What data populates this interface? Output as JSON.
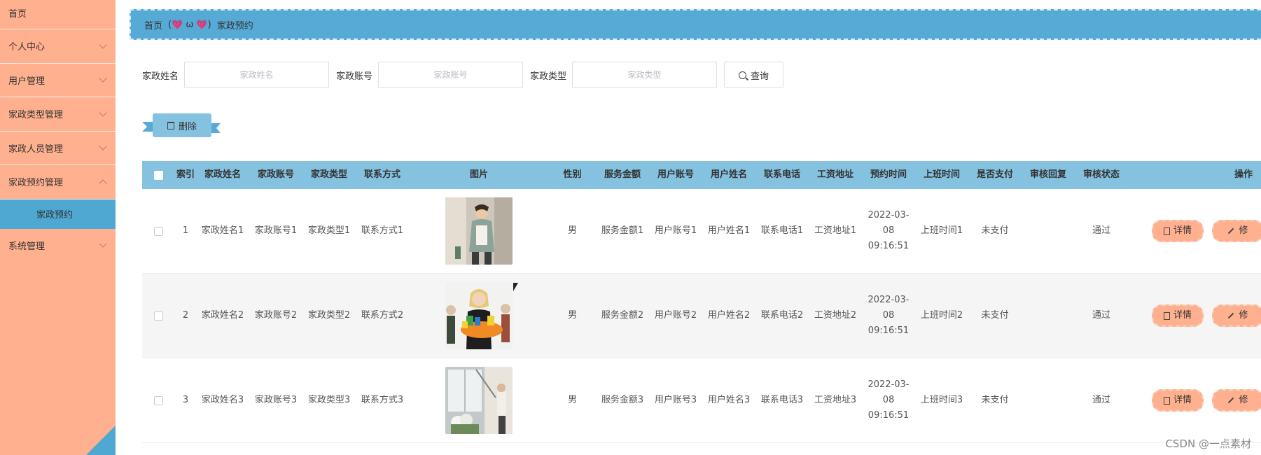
{
  "sidebar": {
    "items": [
      {
        "label": "首页"
      },
      {
        "label": "个人中心"
      },
      {
        "label": "用户管理"
      },
      {
        "label": "家政类型管理"
      },
      {
        "label": "家政人员管理"
      },
      {
        "label": "家政预约管理"
      },
      {
        "label": "系统管理"
      }
    ],
    "submenu_active": "家政预约"
  },
  "breadcrumb": {
    "home": "首页",
    "sep": "(💗 ω 💗)",
    "current": "家政预约"
  },
  "search": {
    "name_label": "家政姓名",
    "name_placeholder": "家政姓名",
    "account_label": "家政账号",
    "account_placeholder": "家政账号",
    "type_label": "家政类型",
    "type_placeholder": "家政类型",
    "query_label": "查询"
  },
  "toolbar": {
    "delete_label": "删除"
  },
  "table": {
    "headers": [
      "索引",
      "家政姓名",
      "家政账号",
      "家政类型",
      "联系方式",
      "图片",
      "性别",
      "服务金额",
      "用户账号",
      "用户姓名",
      "联系电话",
      "工资地址",
      "预约时间",
      "上班时间",
      "是否支付",
      "审核回复",
      "审核状态",
      "操作"
    ],
    "rows": [
      {
        "idx": "1",
        "name": "家政姓名1",
        "account": "家政账号1",
        "type": "家政类型1",
        "contact": "联系方式1",
        "sex": "男",
        "amount": "服务金额1",
        "user_account": "用户账号1",
        "user_name": "用户姓名1",
        "phone": "联系电话1",
        "address": "工资地址1",
        "time": "2022-03-08 09:16:51",
        "work_time": "上班时间1",
        "paid": "未支付",
        "reply": "",
        "status": "通过"
      },
      {
        "idx": "2",
        "name": "家政姓名2",
        "account": "家政账号2",
        "type": "家政类型2",
        "contact": "联系方式2",
        "sex": "男",
        "amount": "服务金额2",
        "user_account": "用户账号2",
        "user_name": "用户姓名2",
        "phone": "联系电话2",
        "address": "工资地址2",
        "time": "2022-03-08 09:16:51",
        "work_time": "上班时间2",
        "paid": "未支付",
        "reply": "",
        "status": "通过"
      },
      {
        "idx": "3",
        "name": "家政姓名3",
        "account": "家政账号3",
        "type": "家政类型3",
        "contact": "联系方式3",
        "sex": "男",
        "amount": "服务金额3",
        "user_account": "用户账号3",
        "user_name": "用户姓名3",
        "phone": "联系电话3",
        "address": "工资地址3",
        "time": "2022-03-08 09:16:51",
        "work_time": "上班时间3",
        "paid": "未支付",
        "reply": "",
        "status": "通过"
      }
    ],
    "ops": {
      "detail": "详情",
      "edit": "修"
    }
  },
  "watermark": "CSDN @一点素材",
  "colors": {
    "sidebar": "#ffb08e",
    "accent": "#56aad5",
    "header": "#84c2e0",
    "op_button": "#ffb08e"
  }
}
